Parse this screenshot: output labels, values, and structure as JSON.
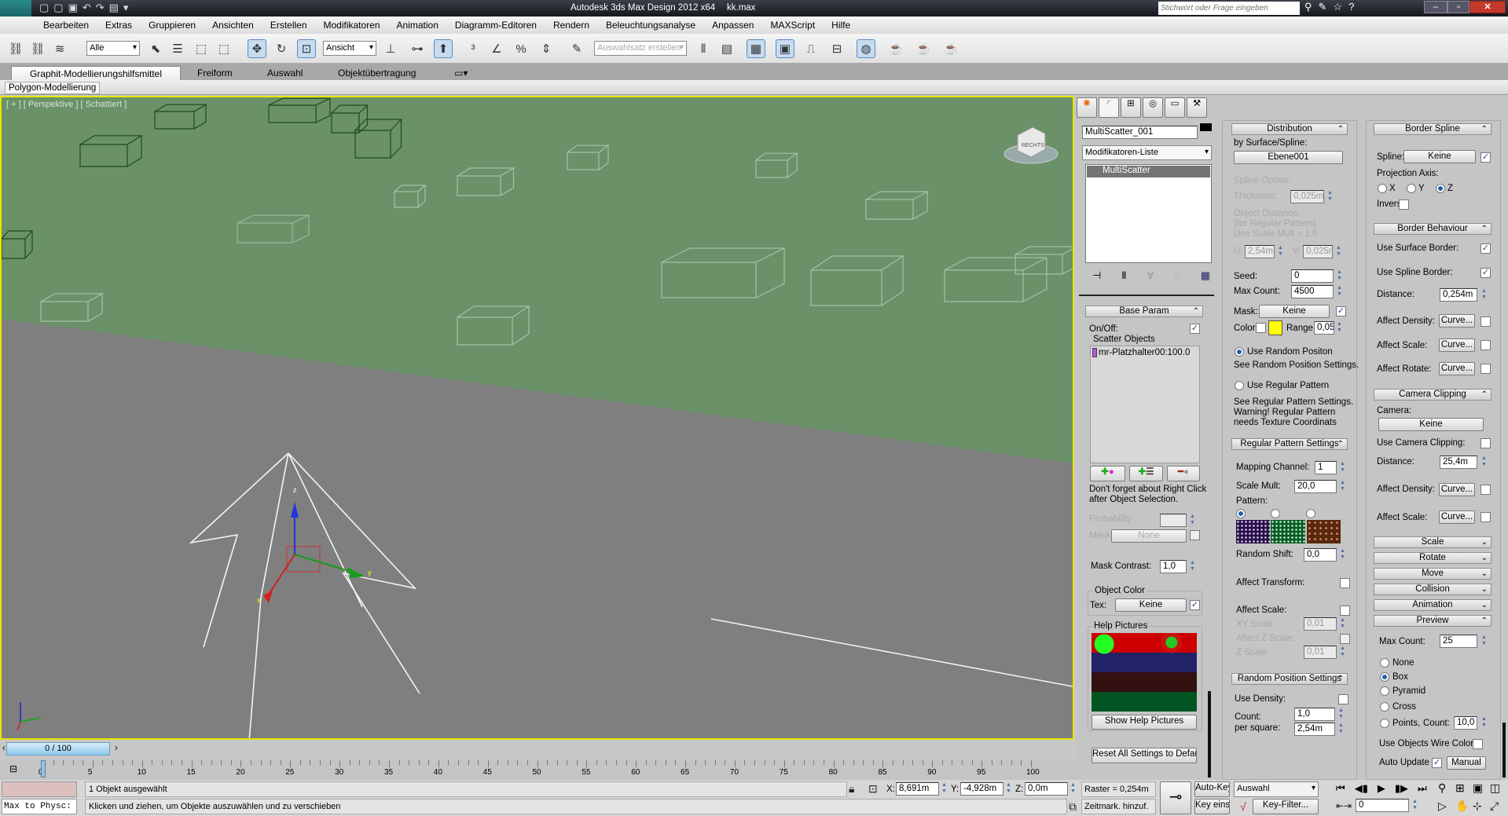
{
  "title_bar": {
    "logo": "3DS",
    "title": "Autodesk 3ds Max Design 2012 x64",
    "file": "kk.max",
    "search_placeholder": "Stichwort oder Frage eingeben"
  },
  "menu": [
    "Bearbeiten",
    "Extras",
    "Gruppieren",
    "Ansichten",
    "Erstellen",
    "Modifikatoren",
    "Animation",
    "Diagramm-Editoren",
    "Rendern",
    "Beleuchtungsanalyse",
    "Anpassen",
    "MAXScript",
    "Hilfe"
  ],
  "toolbar": {
    "selection_filter": "Alle",
    "ref_coord": "Ansicht",
    "named_selection_placeholder": "Auswahlsatz erstellen"
  },
  "ribbon": {
    "tabs": [
      "Graphit-Modellierungshilfsmittel",
      "Freiform",
      "Auswahl",
      "Objektübertragung"
    ],
    "subtab": "Polygon-Modellierung"
  },
  "viewport": {
    "label": "[ + ] [ Perspektive ] [ Schattiert ]",
    "viewcube": "RECHTS",
    "plane_color": "#6a9168",
    "ground_color": "#7f7f7f",
    "border_color": "#e6e600",
    "axis_x": "x",
    "axis_y": "y",
    "axis_z": "z"
  },
  "command_panel": {
    "object_name": "MultiScatter_001",
    "modifier_list": "Modifikatoren-Liste",
    "stack_item": "MultiScatter",
    "base_param": {
      "title": "Base Param",
      "on_off": "On/Off:",
      "on_off_checked": true,
      "scatter_objects": "Scatter Objects",
      "scatter_item": "mr-Platzhalter00:100.0",
      "hint_1": "Don't forget about Right Click",
      "hint_2": "after Object Selection.",
      "probability": "Probability",
      "mask": "Mask",
      "mask_button": "None",
      "mask_contrast": "Mask Contrast:",
      "mask_contrast_value": "1,0",
      "object_color": "Object Color",
      "tex": "Tex:",
      "tex_button": "Keine",
      "tex_checked": true,
      "help_pictures": "Help Pictures",
      "show_help": "Show Help Pictures",
      "reset": "Reset All Settings to Default"
    },
    "distribution": {
      "title": "Distribution",
      "by_surface": "by Surface/Spline:",
      "surface_button": "Ebene001",
      "spline_option": "Spline Option:",
      "thickness": "Thickness:",
      "thickness_value": "0,025m",
      "obj_dist_1": "Object Distance:",
      "obj_dist_2": "(for Regular Pattern)",
      "obj_dist_3": "Use Scale Mult = 1.0",
      "u": "U:",
      "u_value": "2,54m",
      "v": "V:",
      "v_value": "0,025m",
      "seed": "Seed:",
      "seed_value": "0",
      "max_count": "Max Count:",
      "max_count_value": "4500",
      "mask": "Mask:",
      "mask_button": "Keine",
      "mask_checked": true,
      "color": "Color",
      "color_swatch": "#ffff00",
      "range": "Range",
      "range_value": "0,05",
      "random_pos": "Use Random Positon",
      "random_pos_note": "See Random Position Settings.",
      "regular": "Use Regular Pattern",
      "regular_note_1": "See Regular Pattern Settings.",
      "regular_note_2": "Warning! Regular Pattern",
      "regular_note_3": "needs Texture Coordinats"
    },
    "regular_pattern": {
      "title": "Regular Pattern Settings",
      "mapping_channel": "Mapping Channel:",
      "mapping_channel_value": "1",
      "scale_mult": "Scale Mult:",
      "scale_mult_value": "20,0",
      "pattern": "Pattern:",
      "random_shift": "Random Shift:",
      "random_shift_value": "0,0",
      "affect_transform": "Affect Transform:",
      "affect_scale": "Affect Scale:",
      "xy_scale": "XY Scale",
      "xy_scale_value": "0,01",
      "affect_z": "Affect Z Scale:",
      "z_scale": "Z Scale",
      "z_scale_value": "0,01"
    },
    "random_position": {
      "title": "Random Position Settings",
      "use_density": "Use Density:",
      "count": "Count:",
      "count_value": "1,0",
      "per_square": "per square:",
      "per_square_value": "2,54m"
    },
    "border_spline": {
      "title": "Border Spline",
      "spline": "Spline:",
      "spline_button": "Keine",
      "spline_checked": true,
      "projection_axis": "Projection Axis:",
      "x": "X",
      "y": "Y",
      "z": "Z",
      "selected_axis": "Z",
      "inverse": "Inverse:"
    },
    "border_behaviour": {
      "title": "Border Behaviour",
      "surface_border": "Use Surface Border:",
      "spline_border": "Use Spline Border:",
      "distance": "Distance:",
      "distance_value": "0,254m",
      "affect_density": "Affect Density:",
      "affect_scale": "Affect Scale:",
      "affect_rotate": "Affect Rotate:",
      "curve": "Curve..."
    },
    "camera_clipping": {
      "title": "Camera Clipping",
      "camera": "Camera:",
      "camera_button": "Keine",
      "use_clipping": "Use Camera Clipping:",
      "distance": "Distance:",
      "distance_value": "25,4m",
      "affect_density": "Affect Density:",
      "affect_scale": "Affect Scale:",
      "curve": "Curve..."
    },
    "collapsed_rollouts": [
      "Scale",
      "Rotate",
      "Move",
      "Collision",
      "Animation"
    ],
    "preview": {
      "title": "Preview",
      "max_count": "Max Count:",
      "max_count_value": "25",
      "modes": [
        "None",
        "Box",
        "Pyramid",
        "Cross",
        "Points,"
      ],
      "selected_mode": "Box",
      "count": "Count:",
      "count_value": "10,0",
      "wire_color": "Use Objects Wire Color",
      "auto_update": "Auto Update",
      "auto_update_checked": true,
      "manual": "Manual"
    }
  },
  "timeline": {
    "slider": "0 / 100",
    "ticks": [
      0,
      5,
      10,
      15,
      20,
      25,
      30,
      35,
      40,
      45,
      50,
      55,
      60,
      65,
      70,
      75,
      80,
      85,
      90,
      95,
      100
    ]
  },
  "status": {
    "script_listener": "Max to Physc:",
    "selection": "1 Objekt ausgewählt",
    "prompt": "Klicken und ziehen, um Objekte auszuwählen und zu verschieben",
    "x_label": "X:",
    "x": "8,691m",
    "y_label": "Y:",
    "y": "-4,928m",
    "z_label": "Z:",
    "z": "0,0m",
    "grid": "Raster = 0,254m",
    "add_time_tag": "Zeitmark. hinzuf.",
    "auto_key": "Auto-Key",
    "set_key": "Key eins.",
    "key_mode": "Auswahl",
    "key_filter": "Key-Filter...",
    "frame": "0"
  }
}
